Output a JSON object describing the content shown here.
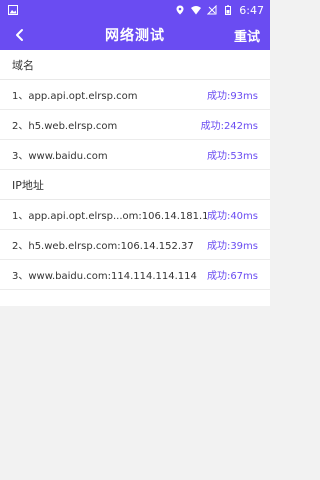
{
  "status_bar": {
    "time": "6:47",
    "icons": [
      "image-icon",
      "location-icon",
      "wifi-icon",
      "signal-icon",
      "battery-icon"
    ]
  },
  "app_bar": {
    "title": "网络测试",
    "retest_label": "重试",
    "back_icon": "back-chevron-icon"
  },
  "sections": [
    {
      "header": "域名",
      "items": [
        {
          "name": "1、app.api.opt.elrsp.com",
          "result": "成功:93ms"
        },
        {
          "name": "2、h5.web.elrsp.com",
          "result": "成功:242ms"
        },
        {
          "name": "3、www.baidu.com",
          "result": "成功:53ms"
        }
      ]
    },
    {
      "header": "IP地址",
      "items": [
        {
          "name": "1、app.api.opt.elrsp...om:106.14.181.127",
          "result": "成功:40ms"
        },
        {
          "name": "2、h5.web.elrsp.com:106.14.152.37",
          "result": "成功:39ms"
        },
        {
          "name": "3、www.baidu.com:114.114.114.114",
          "result": "成功:67ms"
        }
      ]
    }
  ],
  "colors": {
    "primary": "#6a4cf2",
    "background": "#f2f2f2",
    "text": "#333333"
  }
}
